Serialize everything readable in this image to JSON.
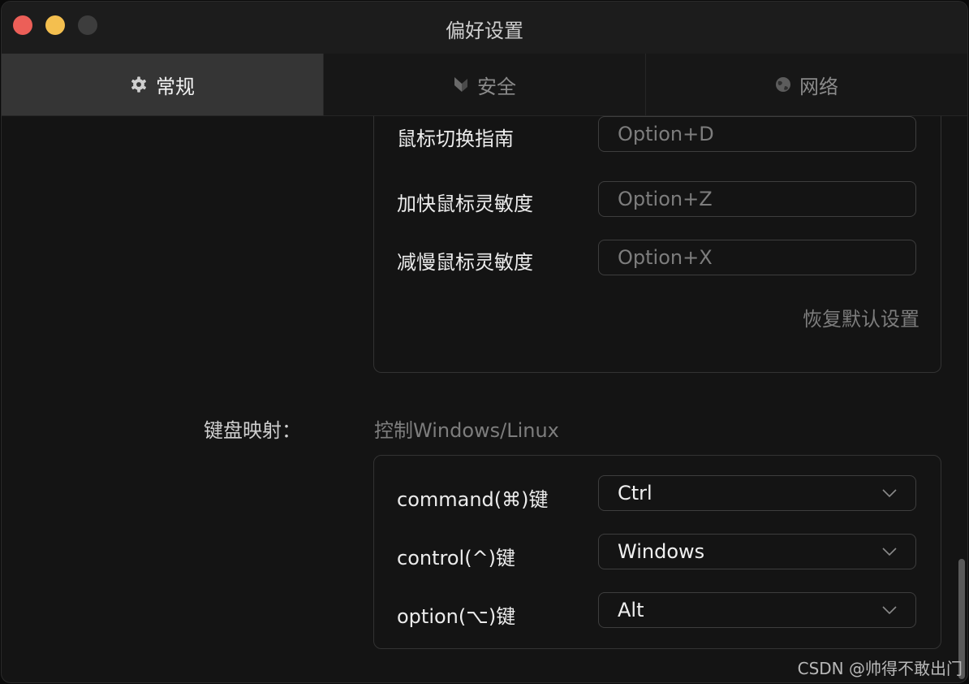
{
  "window": {
    "title": "偏好设置"
  },
  "tabs": [
    {
      "label": "常规",
      "icon": "gear-icon"
    },
    {
      "label": "安全",
      "icon": "shield-icon"
    },
    {
      "label": "网络",
      "icon": "globe-icon"
    }
  ],
  "mouse_shortcuts": [
    {
      "label": "鼠标切换指南",
      "value": "Option+D"
    },
    {
      "label": "加快鼠标灵敏度",
      "value": "Option+Z"
    },
    {
      "label": "减慢鼠标灵敏度",
      "value": "Option+X"
    }
  ],
  "reset_label": "恢复默认设置",
  "keyboard_mapping": {
    "label": "键盘映射：",
    "subtitle": "控制Windows/Linux",
    "rows": [
      {
        "label": "command(⌘)键",
        "value": "Ctrl"
      },
      {
        "label": "control(^)键",
        "value": "Windows"
      },
      {
        "label": "option(⌥)键",
        "value": "Alt"
      }
    ]
  },
  "watermark": "CSDN @帅得不敢出门",
  "colors": {
    "close": "#ec5f58",
    "minimize": "#f4bf4f",
    "maximize": "#3d3d3d",
    "active_tab": "#353535"
  }
}
